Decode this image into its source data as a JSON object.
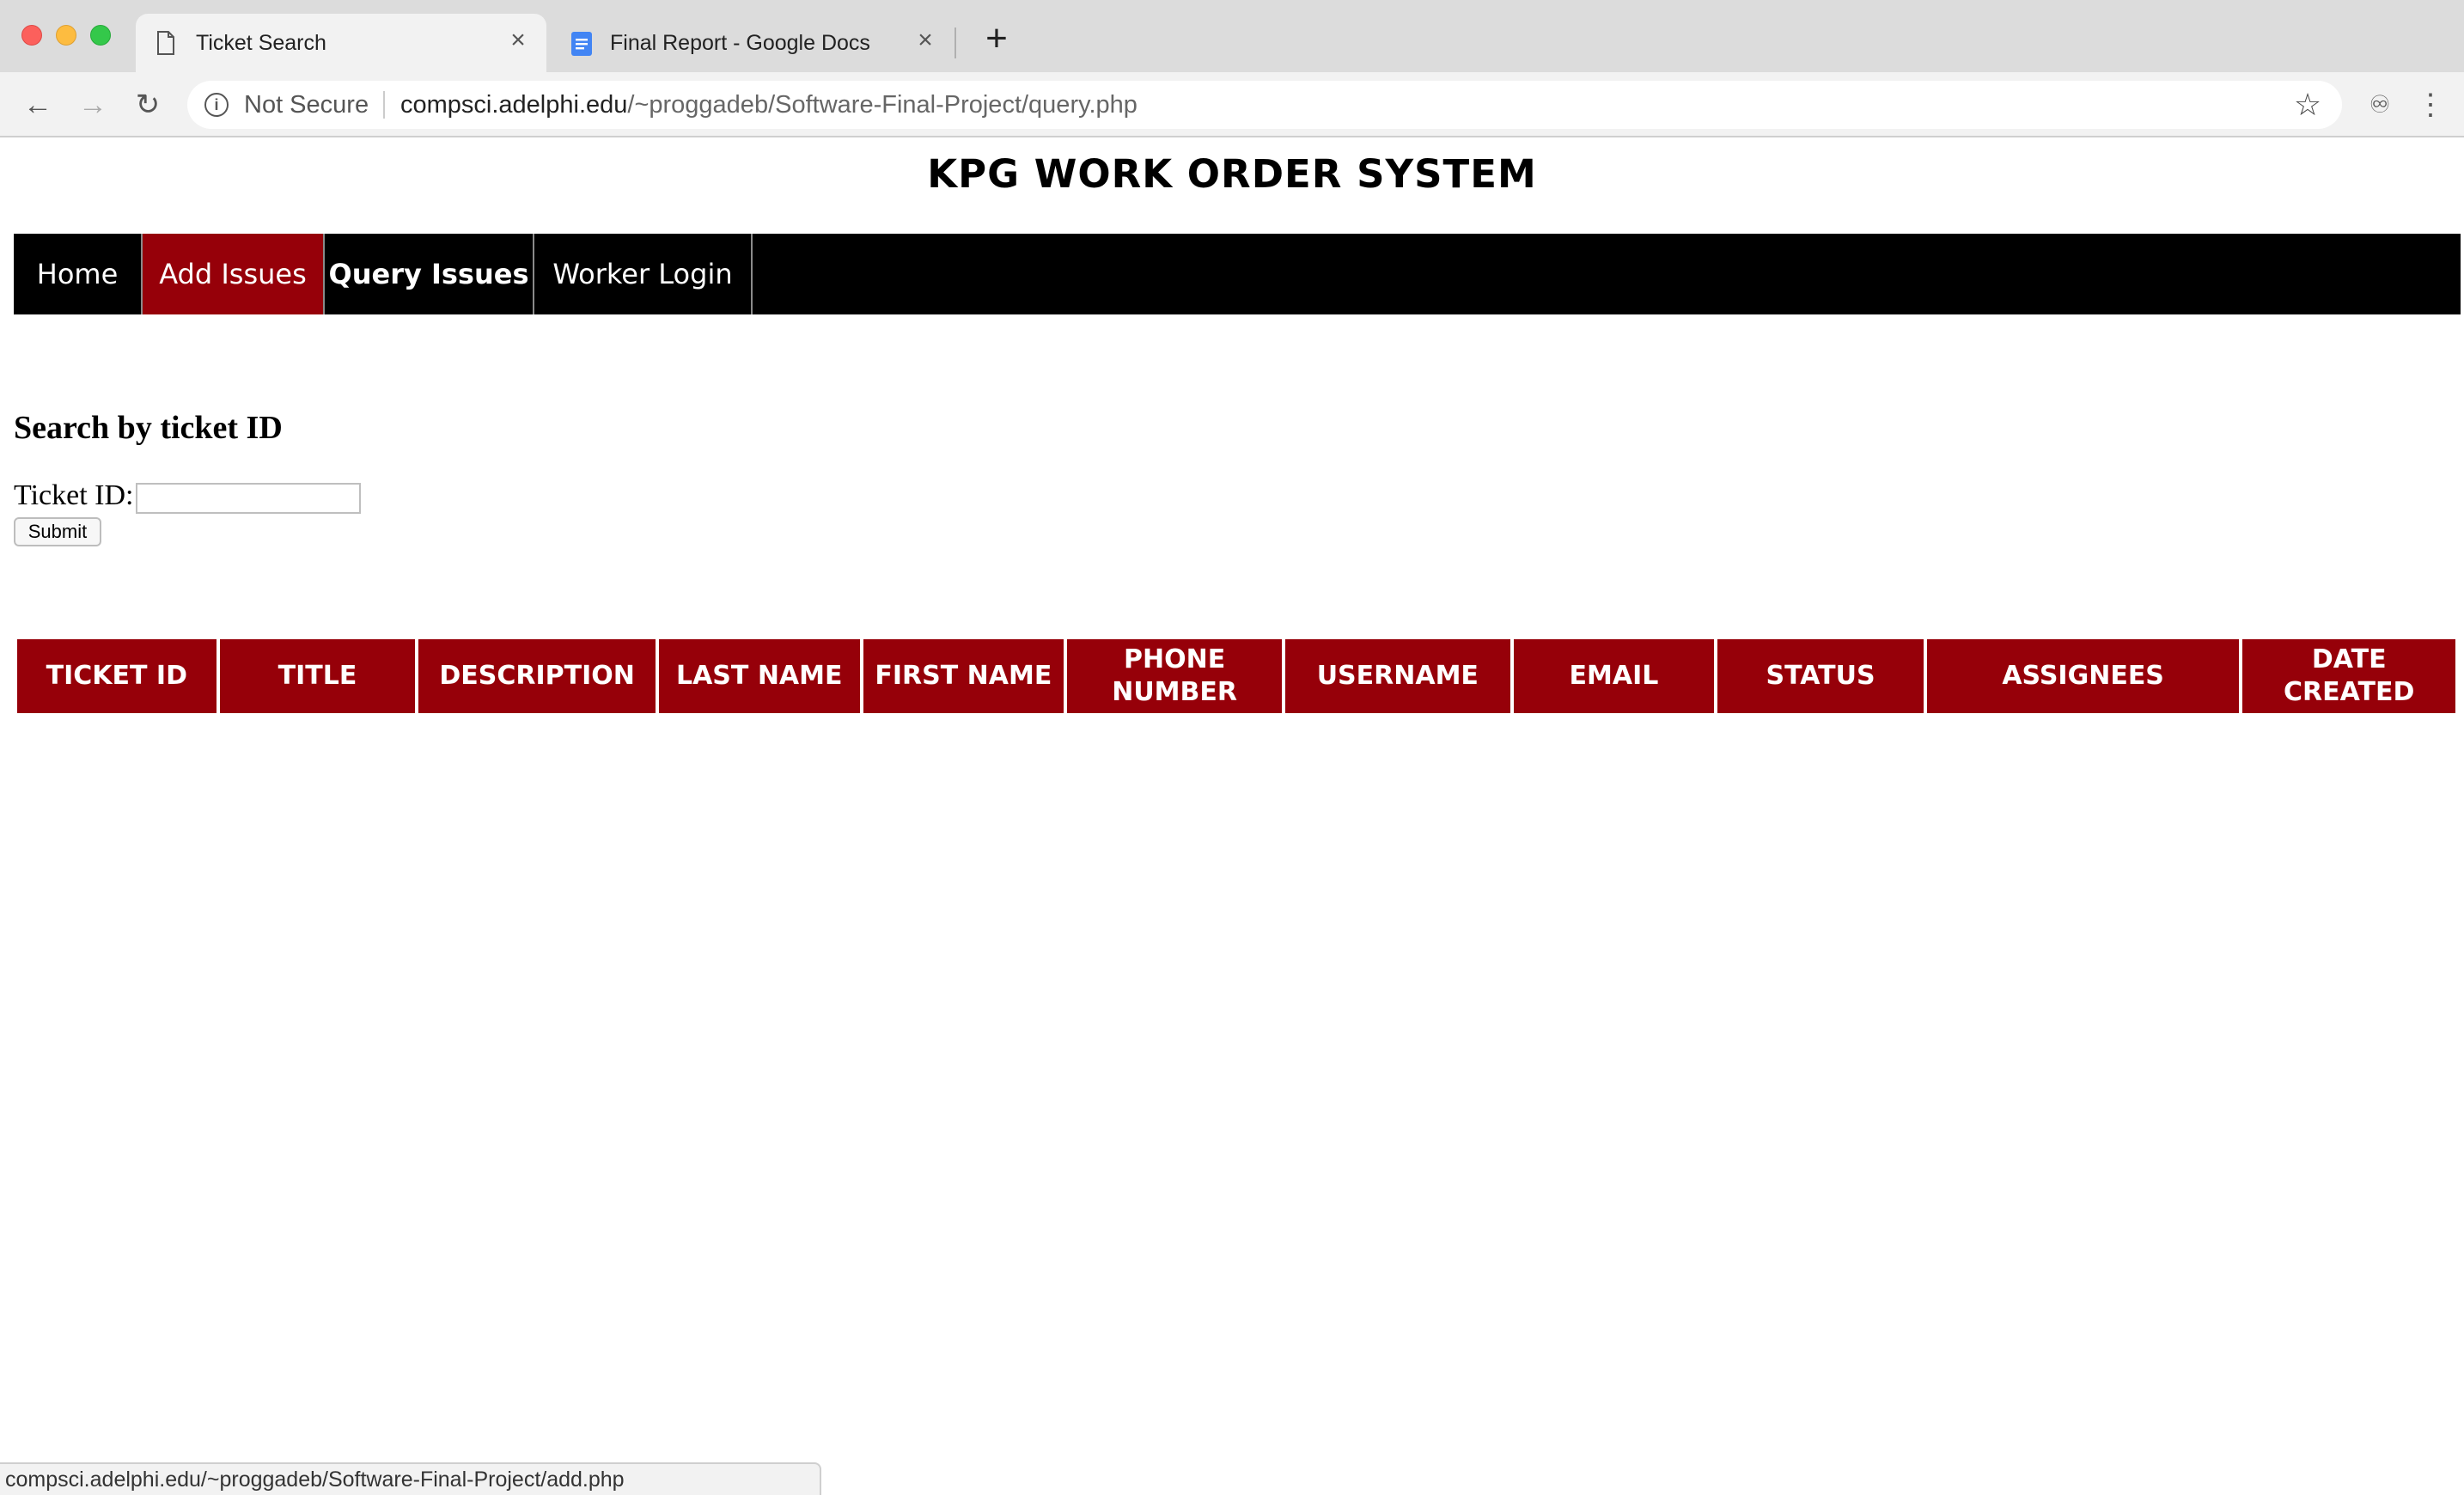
{
  "browser": {
    "tabs": [
      {
        "title": "Ticket Search",
        "icon": "document-icon",
        "active": true
      },
      {
        "title": "Final Report - Google Docs",
        "icon": "google-docs-icon",
        "active": false
      }
    ],
    "close_glyph": "×",
    "newtab_glyph": "+",
    "back_glyph": "←",
    "forward_glyph": "→",
    "reload_glyph": "↻",
    "info_glyph": "i",
    "security_label": "Not Secure",
    "url_host": "compsci.adelphi.edu",
    "url_path": "/~proggadeb/Software-Final-Project/query.php",
    "star_glyph": "☆",
    "ext_glyph": "♾",
    "menu_glyph": "⋮",
    "status_url": "compsci.adelphi.edu/~proggadeb/Software-Final-Project/add.php"
  },
  "page": {
    "site_title": "KPG WORK ORDER SYSTEM",
    "nav": [
      {
        "label": "Home"
      },
      {
        "label": "Add Issues"
      },
      {
        "label": "Query Issues"
      },
      {
        "label": "Worker Login"
      }
    ],
    "search": {
      "heading": "Search by ticket ID",
      "label": "Ticket ID:",
      "input_value": "",
      "submit_label": "Submit"
    },
    "table": {
      "headers": [
        "TICKET ID",
        "TITLE",
        "DESCRIPTION",
        "LAST NAME",
        "FIRST NAME",
        "PHONE NUMBER",
        "USERNAME",
        "EMAIL",
        "STATUS",
        "ASSIGNEES",
        "DATE CREATED"
      ],
      "rows": []
    }
  },
  "colors": {
    "accent": "#960009",
    "nav_bg": "#000000"
  }
}
